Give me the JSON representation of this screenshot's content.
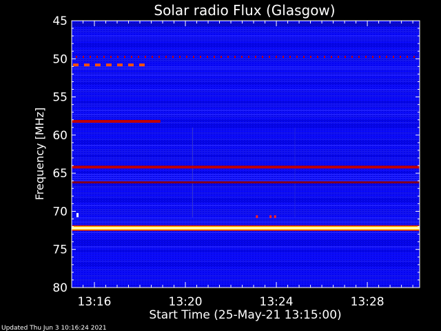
{
  "chart_data": {
    "type": "heatmap",
    "title": "Solar radio Flux (Glasgow)",
    "xlabel": "Start Time (25-May-21 13:15:00)",
    "ylabel": "Frequency [MHz]",
    "x_range_minutes": [
      0,
      15.3
    ],
    "ylim": [
      45,
      80
    ],
    "y_inverted": true,
    "yticks": [
      "45",
      "50",
      "55",
      "60",
      "65",
      "70",
      "75",
      "80"
    ],
    "yticks_values": [
      45,
      50,
      55,
      60,
      65,
      70,
      75,
      80
    ],
    "xticks": [
      "13:16",
      "13:20",
      "13:24",
      "13:28"
    ],
    "xticks_minutes": [
      1,
      5,
      9,
      13
    ],
    "background_intensity": "blue",
    "colormap": [
      "#0000ff",
      "#2020c0",
      "#b00000",
      "#ff3000",
      "#ffb000",
      "#ffff80",
      "#ffffff"
    ],
    "features": [
      {
        "label": "strong continuous emission",
        "freq_mhz": 72.2,
        "t_start_min": 0,
        "t_end_min": 15.3,
        "level": "saturated"
      },
      {
        "label": "continuous line",
        "freq_mhz": 64.2,
        "t_start_min": 0,
        "t_end_min": 15.3,
        "level": "high"
      },
      {
        "label": "continuous line",
        "freq_mhz": 66.2,
        "t_start_min": 0,
        "t_end_min": 15.3,
        "level": "medium"
      },
      {
        "label": "partial line",
        "freq_mhz": 58.2,
        "t_start_min": 0,
        "t_end_min": 3.9,
        "level": "high"
      },
      {
        "label": "dashed line",
        "freq_mhz": 50.8,
        "t_start_min": 0,
        "t_end_min": 3.2,
        "level": "very high"
      },
      {
        "label": "dotted line",
        "freq_mhz": 49.7,
        "t_start_min": 0,
        "t_end_min": 15.3,
        "level": "high"
      },
      {
        "label": "short burst",
        "freq_mhz": 70.7,
        "t_start_min": 8.1,
        "t_end_min": 8.9,
        "level": "high"
      }
    ]
  },
  "footer": {
    "updated": "Updated Thu Jun  3 10:16:24 2021"
  }
}
